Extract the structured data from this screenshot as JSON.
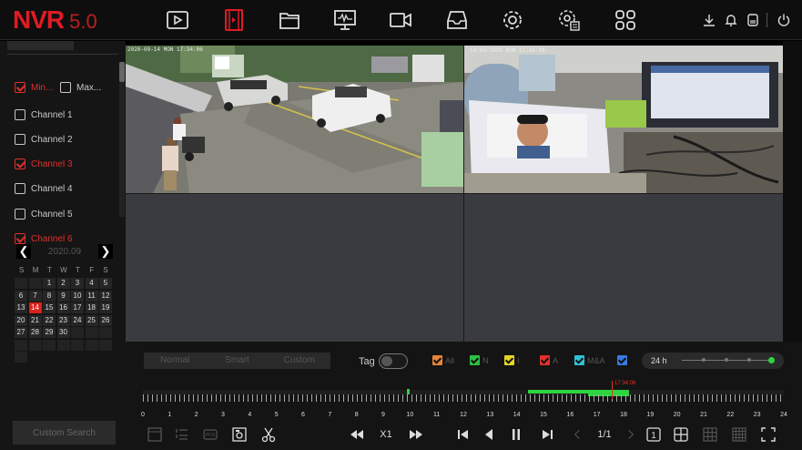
{
  "app": {
    "logo": "NVR",
    "version": "5.0"
  },
  "topnav": [
    "playback-icon",
    "video-clip-icon",
    "folder-icon",
    "monitor-icon",
    "camera-icon",
    "archive-icon",
    "settings-icon",
    "system-settings-icon",
    "apps-grid-icon"
  ],
  "top_right": [
    "download-icon",
    "bell-icon",
    "storage-icon",
    "power-icon"
  ],
  "sidebar": {
    "filters": [
      {
        "label": "Min...",
        "checked": true
      },
      {
        "label": "Max...",
        "checked": false
      }
    ],
    "channels": [
      {
        "label": "Channel 1",
        "checked": false
      },
      {
        "label": "Channel 2",
        "checked": false
      },
      {
        "label": "Channel 3",
        "checked": true
      },
      {
        "label": "Channel 4",
        "checked": false
      },
      {
        "label": "Channel 5",
        "checked": false
      },
      {
        "label": "Channel 6",
        "checked": true
      }
    ],
    "calendar": {
      "month": "2020.09",
      "dow": [
        "S",
        "M",
        "T",
        "W",
        "T",
        "F",
        "S"
      ],
      "days": [
        "",
        "",
        "1",
        "2",
        "3",
        "4",
        "5",
        "6",
        "7",
        "8",
        "9",
        "10",
        "11",
        "12",
        "13",
        "14",
        "15",
        "16",
        "17",
        "18",
        "19",
        "20",
        "21",
        "22",
        "23",
        "24",
        "25",
        "26",
        "27",
        "28",
        "29",
        "30",
        "",
        "",
        "",
        "",
        "",
        "",
        "",
        "",
        "",
        "",
        ""
      ],
      "selected": "14"
    },
    "custom_search": "Custom Search"
  },
  "cameras": {
    "cam1_osd": "2020-09-14 MON 17:34:06",
    "cam2_osd": "14/09/2020 MON 17:34:06"
  },
  "playback": {
    "modes": [
      "Normal",
      "Smart",
      "Custom"
    ],
    "tag_label": "Tag",
    "event_filters": [
      {
        "label": "All",
        "color": "#e8833a"
      },
      {
        "label": "N",
        "color": "#2dc043"
      },
      {
        "label": "I",
        "color": "#e6d620"
      },
      {
        "label": "A",
        "color": "#e0302a"
      },
      {
        "label": "M&A",
        "color": "#2ec4d6"
      },
      {
        "label": "",
        "color": "#3a78e0"
      }
    ],
    "zoom_label": "24 h",
    "current_time": "17:34:06",
    "hours": [
      "0",
      "1",
      "2",
      "3",
      "4",
      "5",
      "6",
      "7",
      "8",
      "9",
      "10",
      "11",
      "12",
      "13",
      "14",
      "15",
      "16",
      "17",
      "18",
      "19",
      "20",
      "21",
      "22",
      "23",
      "24"
    ],
    "speed": "X1",
    "page": "1/1"
  },
  "colors": {
    "accent": "#e01b24",
    "record": "#2ed43f"
  }
}
